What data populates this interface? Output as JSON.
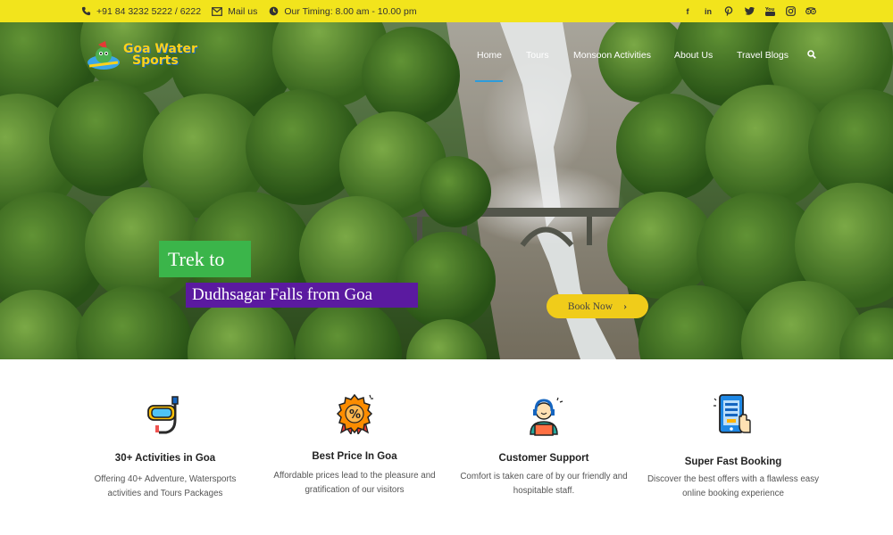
{
  "topbar": {
    "phone": "+91 84 3232 5222 / 6222",
    "mail": "Mail us",
    "timing": "Our Timing: 8.00 am - 10.00 pm",
    "social_icons": [
      "facebook-icon",
      "linkedin-icon",
      "pinterest-icon",
      "twitter-icon",
      "youtube-icon",
      "instagram-icon",
      "tripadvisor-icon"
    ]
  },
  "logo": {
    "line1": "Goa Water",
    "line2": "Sports"
  },
  "nav": {
    "items": [
      {
        "label": "Home",
        "active": true
      },
      {
        "label": "Tours"
      },
      {
        "label": "Monsoon Activities"
      },
      {
        "label": "About Us"
      },
      {
        "label": "Travel Blogs"
      }
    ],
    "search_icon": "search-icon"
  },
  "hero": {
    "title_line1": "Trek to",
    "title_line2": "Dudhsagar Falls from Goa",
    "button_label": "Book Now",
    "colors": {
      "title1_bg": "#3bb54a",
      "title2_bg": "#5b1aa0",
      "button_bg": "#f0cc1a",
      "topbar_bg": "#f2e41c"
    }
  },
  "features": [
    {
      "icon": "snorkel-mask-icon",
      "title": "30+ Activities in Goa",
      "text_lines": [
        "Offering 40+ Adventure, Watersports",
        "activities and Tours Packages"
      ]
    },
    {
      "icon": "discount-badge-icon",
      "title": "Best Price In Goa",
      "text_lines": [
        "Affordable prices lead to the pleasure and",
        "gratification of our visitors"
      ]
    },
    {
      "icon": "customer-support-icon",
      "title": "Customer Support",
      "text_lines": [
        "Comfort is taken care of by our friendly and",
        "hospitable staff."
      ]
    },
    {
      "icon": "mobile-booking-icon",
      "title": "Super Fast Booking",
      "text_lines": [
        "Discover the best offers with a flawless easy",
        "online booking experience"
      ]
    }
  ]
}
